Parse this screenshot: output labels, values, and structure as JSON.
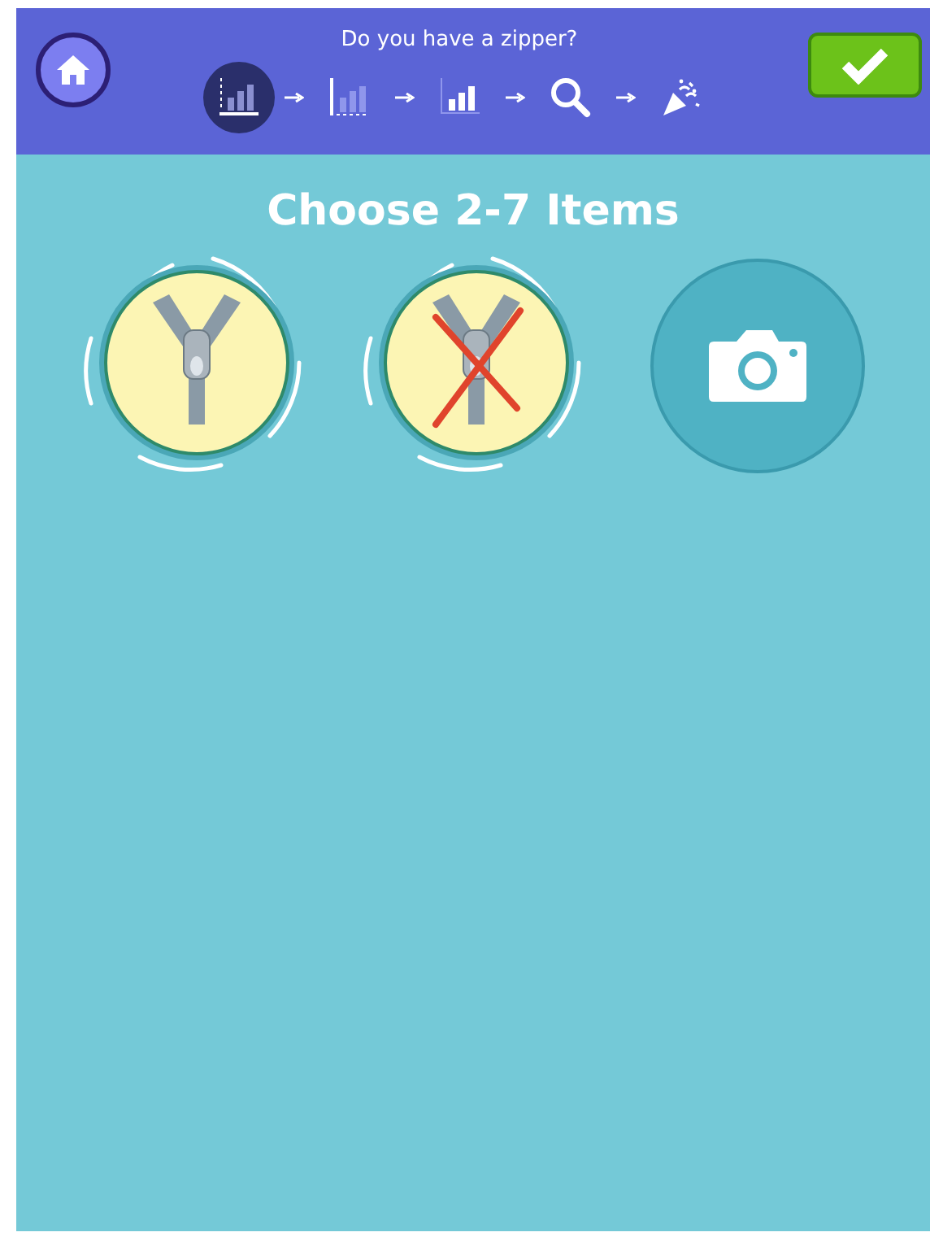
{
  "header": {
    "title": "Do you have a zipper?"
  },
  "steps": [
    {
      "kind": "chart",
      "selected": true
    },
    {
      "kind": "axis",
      "selected": false
    },
    {
      "kind": "bars",
      "selected": false
    },
    {
      "kind": "search",
      "selected": false
    },
    {
      "kind": "party",
      "selected": false
    }
  ],
  "heading": "Choose 2-7 Items",
  "options": [
    {
      "kind": "zipper",
      "crossed": false
    },
    {
      "kind": "zipper",
      "crossed": true
    },
    {
      "kind": "camera"
    }
  ]
}
